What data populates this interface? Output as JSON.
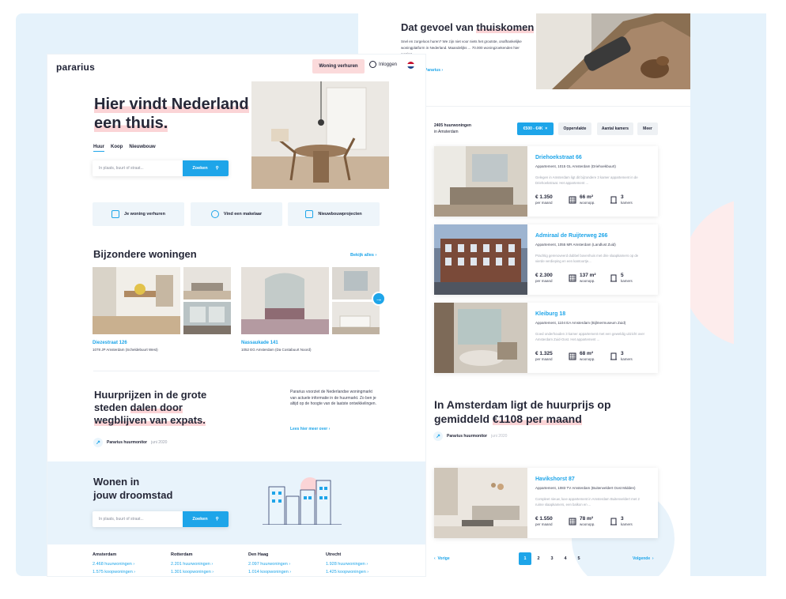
{
  "colors": {
    "accent": "#1ea5e9",
    "highlight": "#fbd4d6",
    "background": "#e5f2fb",
    "dark": "#262838"
  },
  "header": {
    "logo": "pararius",
    "verhuren_button": "Woning verhuren",
    "login_label": "Inloggen",
    "flag_icon": "netherlands-flag-icon"
  },
  "hero": {
    "title_line1": "Hier vindt Nederland",
    "title_line2": "een thuis.",
    "tabs": [
      "Huur",
      "Koop",
      "Nieuwbouw"
    ],
    "search_placeholder": "In plaats, buurt of straat...",
    "search_button": "Zoeken"
  },
  "quick_links": [
    {
      "label": "Je woning verhuren",
      "icon": "house-icon"
    },
    {
      "label": "Vind een makelaar",
      "icon": "chat-icon"
    },
    {
      "label": "Nieuwbouwprojecten",
      "icon": "building-icon"
    }
  ],
  "special": {
    "title": "Bijzondere woningen",
    "view_all": "Bekijk alles",
    "items": [
      {
        "name": "Diezestraat 126",
        "address": "1078 JP Amsterdam (Scheldebuurt West)"
      },
      {
        "name": "Nassaukade 141",
        "address": "1052 EG Amsterdam (Da Costabuurt Noord)"
      }
    ]
  },
  "monitor": {
    "title_a": "Huurprijzen in de grote",
    "title_b": "steden ",
    "title_hl": "dalen door",
    "title_c": "wegblijven van expats.",
    "source": "Pararius huurmonitor",
    "date": "juni 2020",
    "paragraph": "Pararius voorziet de Nederlandse woningmarkt van actuele informatie in de huurmarkt. Zo ben je altijd op de hoogte van de laatste ontwikkelingen.",
    "read_more": "Lees hier meer over"
  },
  "dream": {
    "title_line1": "Wonen in",
    "title_line2": "jouw droomstad",
    "search_placeholder": "In plaats, buurt of straat...",
    "search_button": "Zoeken",
    "cities": [
      {
        "name": "Amsterdam",
        "rent": "2.468 huurwoningen",
        "buy": "1.575 koopwoningen"
      },
      {
        "name": "Rotterdam",
        "rent": "2.201 huurwoningen",
        "buy": "1.301 koopwoningen"
      },
      {
        "name": "Den Haag",
        "rent": "2.097 huurwoningen",
        "buy": "1.014 koopwoningen"
      },
      {
        "name": "Utrecht",
        "rent": "1.928 huurwoningen",
        "buy": "1.425 koopwoningen"
      }
    ]
  },
  "right": {
    "title_a": "Dat gevoel van ",
    "title_hl": "thuiskomen",
    "subtitle": "Snel en zorgeloos huren? We zijn niet voor niets het grootste, onafhankelijke woningplatform in Nederland. Maandelijks ... 70.000 woningzoekenden hier woning.",
    "link": "Pararius",
    "count_a": "2405 huurwoningen",
    "count_b": "in Amsterdam",
    "filters": [
      "€500 - €4K",
      "Oppervlakte",
      "Aantal kamers",
      "Meer"
    ],
    "listings": [
      {
        "title": "Driehoekstraat 66",
        "address": "Appartement, 1015 GL Amsterdam (Driehoekbuurt)",
        "desc": "Gelegen in Amsterdam ligt dit bijzondere 3 kamer appartement in de Driehoekstraat. Het appartement ...",
        "price": "€ 1.350",
        "price_unit": "per maand",
        "area": "66 m²",
        "area_unit": "woonopp.",
        "rooms": "3",
        "rooms_unit": "kamers"
      },
      {
        "title": "Admiraal de Ruijterweg 266",
        "address": "Appartement, 1055 MR Amsterdam (Landlust Zuid)",
        "desc": "Prachtig gerenoveerd dubbel bovenhuis met drie slaapkamers op de vierde verdieping en een kantoortje...",
        "price": "€ 2.300",
        "price_unit": "per maand",
        "area": "137 m²",
        "area_unit": "woonopp.",
        "rooms": "5",
        "rooms_unit": "kamers"
      },
      {
        "title": "Kleiburg 18",
        "address": "Appartement, 1104 EA Amsterdam (Bijlmermuseum Zuid)",
        "desc": "Goed onderhouden 3 kamer appartement met een geweldig uitzicht over Amsterdam Zuid-Oost. Het appartement ...",
        "price": "€ 1.325",
        "price_unit": "per maand",
        "area": "68 m²",
        "area_unit": "woonopp.",
        "rooms": "3",
        "rooms_unit": "kamers"
      },
      {
        "title": "Havikshorst 87",
        "address": "Appartement, 1083 TV Amsterdam (Buitenveldert Oost Midden)",
        "desc": "Compleet nieuw, luxe appartement in Amsterdam Buitenveldert met 2 ruime slaapkamers, een balkon en ...",
        "price": "€ 1.550",
        "price_unit": "per maand",
        "area": "78 m²",
        "area_unit": "woonopp.",
        "rooms": "3",
        "rooms_unit": "kamers"
      }
    ],
    "big_a": "In Amsterdam ligt de huurprijs op",
    "big_b": "gemiddeld ",
    "big_hl": "€1108 per maand",
    "monitor_source": "Pararius huurmonitor",
    "monitor_date": "juni 2020",
    "pagination": {
      "prev": "Vorige",
      "next": "Volgende",
      "pages": [
        "1",
        "2",
        "3",
        "4",
        "5"
      ],
      "current": "1"
    }
  }
}
